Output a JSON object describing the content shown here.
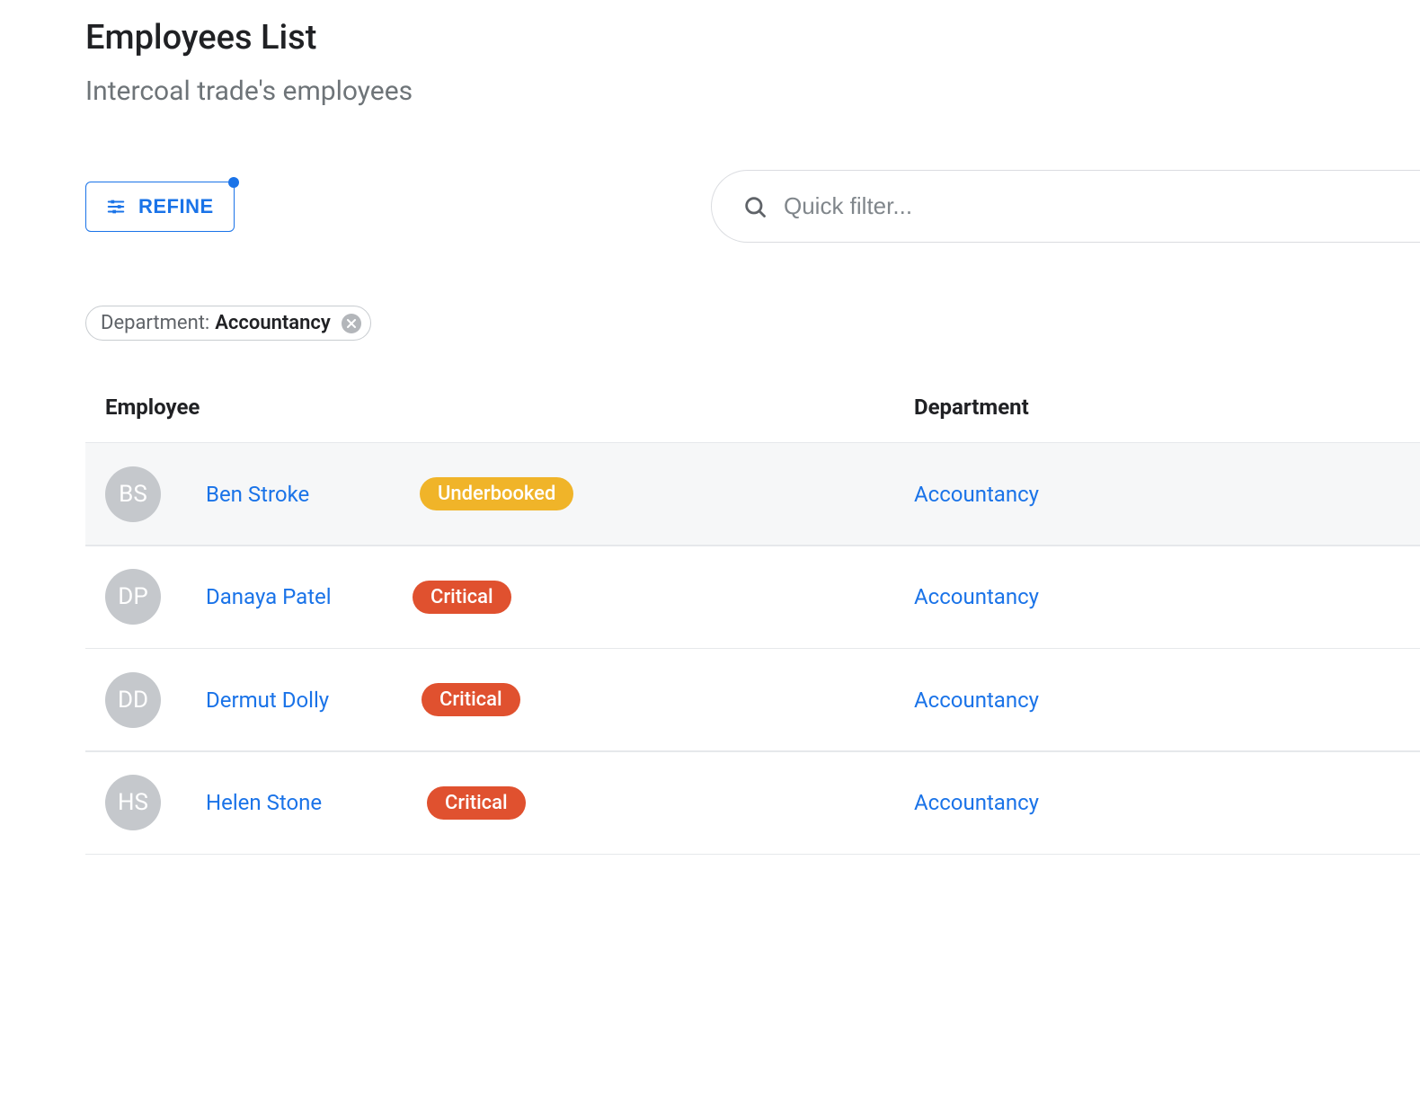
{
  "header": {
    "title": "Employees List",
    "subtitle": "Intercoal trade's employees"
  },
  "controls": {
    "refine_label": "REFINE",
    "search": {
      "placeholder": "Quick filter...",
      "value": ""
    }
  },
  "filters": {
    "active_chip": {
      "label": "Department:",
      "value": "Accountancy"
    }
  },
  "table": {
    "columns": {
      "employee": "Employee",
      "department": "Department"
    },
    "rows": [
      {
        "initials": "BS",
        "name": "Ben Stroke",
        "status": "Underbooked",
        "status_kind": "warn",
        "department": "Accountancy",
        "highlight": true
      },
      {
        "initials": "DP",
        "name": "Danaya Patel",
        "status": "Critical",
        "status_kind": "crit",
        "department": "Accountancy",
        "highlight": false
      },
      {
        "initials": "DD",
        "name": "Dermut Dolly",
        "status": "Critical",
        "status_kind": "crit",
        "department": "Accountancy",
        "highlight": false
      },
      {
        "initials": "HS",
        "name": "Helen Stone",
        "status": "Critical",
        "status_kind": "crit",
        "department": "Accountancy",
        "highlight": false
      }
    ]
  }
}
